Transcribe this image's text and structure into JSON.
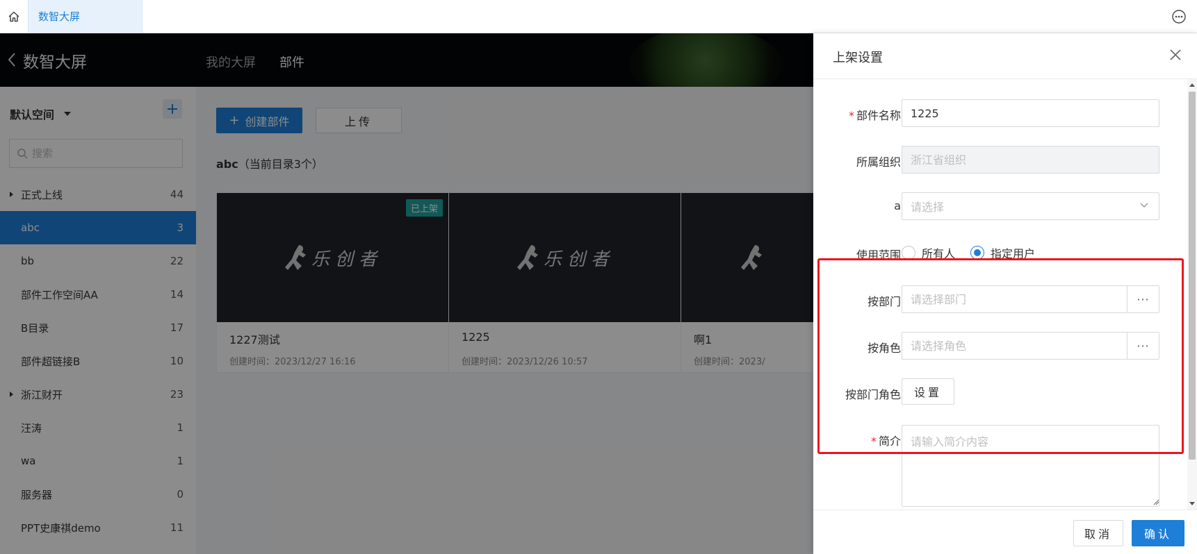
{
  "tabbar": {
    "active_tab": "数智大屏"
  },
  "header": {
    "title": "数智大屏",
    "nav": [
      "我的大屏",
      "部件"
    ]
  },
  "sidebar": {
    "space_name": "默认空间",
    "search_placeholder": "搜索",
    "items": [
      {
        "label": "正式上线",
        "count": "44",
        "expandable": true
      },
      {
        "label": "abc",
        "count": "3",
        "selected": true
      },
      {
        "label": "bb",
        "count": "22"
      },
      {
        "label": "部件工作空间AA",
        "count": "14"
      },
      {
        "label": "B目录",
        "count": "17"
      },
      {
        "label": "部件超链接B",
        "count": "10"
      },
      {
        "label": "浙江财开",
        "count": "23",
        "expandable": true
      },
      {
        "label": "汪涛",
        "count": "1"
      },
      {
        "label": "wa",
        "count": "1"
      },
      {
        "label": "服务器",
        "count": "0"
      },
      {
        "label": "PPT史康祺demo",
        "count": "11"
      }
    ]
  },
  "main": {
    "create_label": "创建部件",
    "upload_label": "上传",
    "dir_name": "abc",
    "dir_count_text": "（当前目录3个）",
    "cards": [
      {
        "title": "1227测试",
        "time": "创建时间：2023/12/27 16:16",
        "badge": "已上架",
        "logo": "乐创者"
      },
      {
        "title": "1225",
        "time": "创建时间：2023/12/26 10:57",
        "logo": "乐创者"
      },
      {
        "title": "啊1",
        "time": "创建时间：2023/",
        "logo": "乐创者"
      }
    ]
  },
  "drawer": {
    "title": "上架设置",
    "fields": {
      "name_label": "部件名称",
      "name_value": "1225",
      "org_label": "所属组织",
      "org_placeholder": "浙江省组织",
      "a_label": "a",
      "a_placeholder": "请选择",
      "scope_label": "使用范围",
      "scope_options": [
        "所有人",
        "指定用户"
      ],
      "dept_label": "按部门",
      "dept_placeholder": "请选择部门",
      "role_label": "按角色",
      "role_placeholder": "请选择角色",
      "deptrole_label": "按部门角色",
      "deptrole_button": "设置",
      "intro_label": "简介",
      "intro_placeholder": "请输入简介内容",
      "more": "···"
    },
    "cancel_label": "取消",
    "ok_label": "确认"
  },
  "colors": {
    "primary": "#1e7fd9",
    "highlight": "#f0131e",
    "badge": "#20a39e"
  }
}
